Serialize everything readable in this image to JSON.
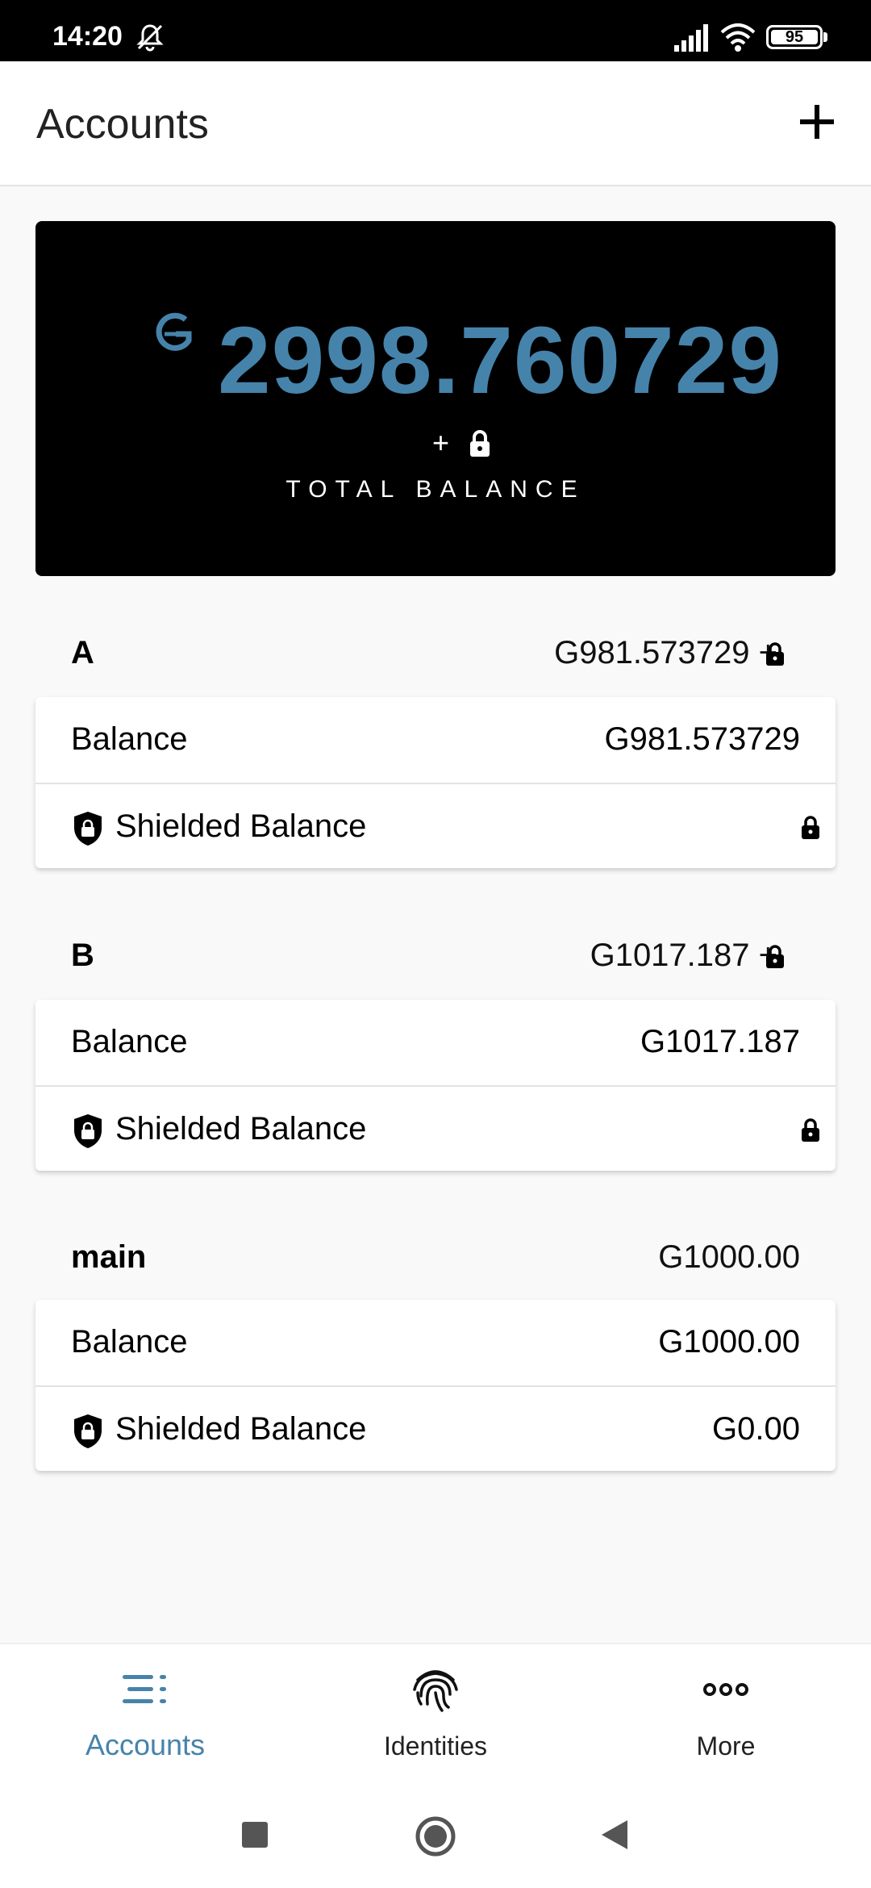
{
  "status": {
    "time": "14:20",
    "battery": "95"
  },
  "header": {
    "title": "Accounts"
  },
  "total": {
    "symbol": "G",
    "amount": "2998.760729",
    "plus": "+",
    "label": "TOTAL BALANCE"
  },
  "accounts": [
    {
      "name": "A",
      "total": "G981.573729 +",
      "balance_label": "Balance",
      "balance": "G981.573729",
      "shielded_label": "Shielded Balance",
      "shielded": ""
    },
    {
      "name": "B",
      "total": "G1017.187 +",
      "balance_label": "Balance",
      "balance": "G1017.187",
      "shielded_label": "Shielded Balance",
      "shielded": ""
    },
    {
      "name": "main",
      "total": "G1000.00",
      "balance_label": "Balance",
      "balance": "G1000.00",
      "shielded_label": "Shielded Balance",
      "shielded": "G0.00"
    }
  ],
  "nav": {
    "items": [
      {
        "label": "Accounts",
        "icon": "list-icon",
        "active": true
      },
      {
        "label": "Identities",
        "icon": "fingerprint-icon",
        "active": false
      },
      {
        "label": "More",
        "icon": "more-icon",
        "active": false
      }
    ]
  },
  "colors": {
    "accent": "#4683ab",
    "card_bg": "#000000",
    "page_bg": "#f9f9f9"
  }
}
